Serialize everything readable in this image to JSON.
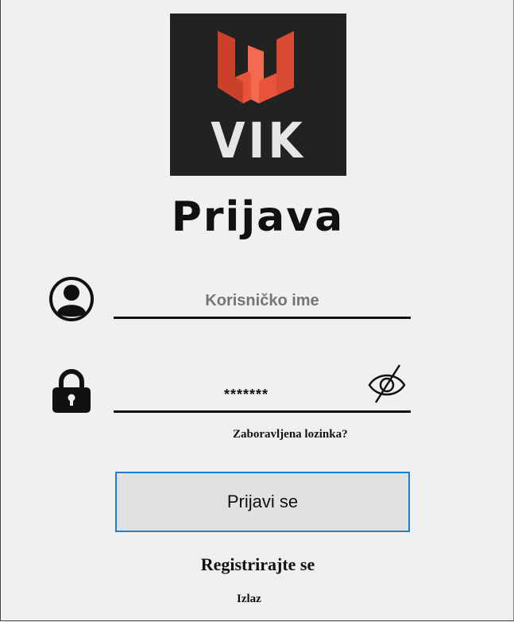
{
  "logo": {
    "text": "VIK",
    "icon": "vik-w-logo"
  },
  "title": "Prijava",
  "username": {
    "placeholder": "Korisničko ime",
    "value": "",
    "icon": "user-icon"
  },
  "password": {
    "value": "*******",
    "icon": "lock-icon",
    "toggle_icon": "eye-slash-icon"
  },
  "forgot_link": "Zaboravljena lozinka?",
  "login_button": "Prijavi se",
  "register_link": "Registrirajte se",
  "exit_link": "Izlaz",
  "colors": {
    "accent": "#1a7fd6",
    "logo_bg": "#222222",
    "logo_mark": "#e8543a",
    "background": "#f0f0f0"
  }
}
